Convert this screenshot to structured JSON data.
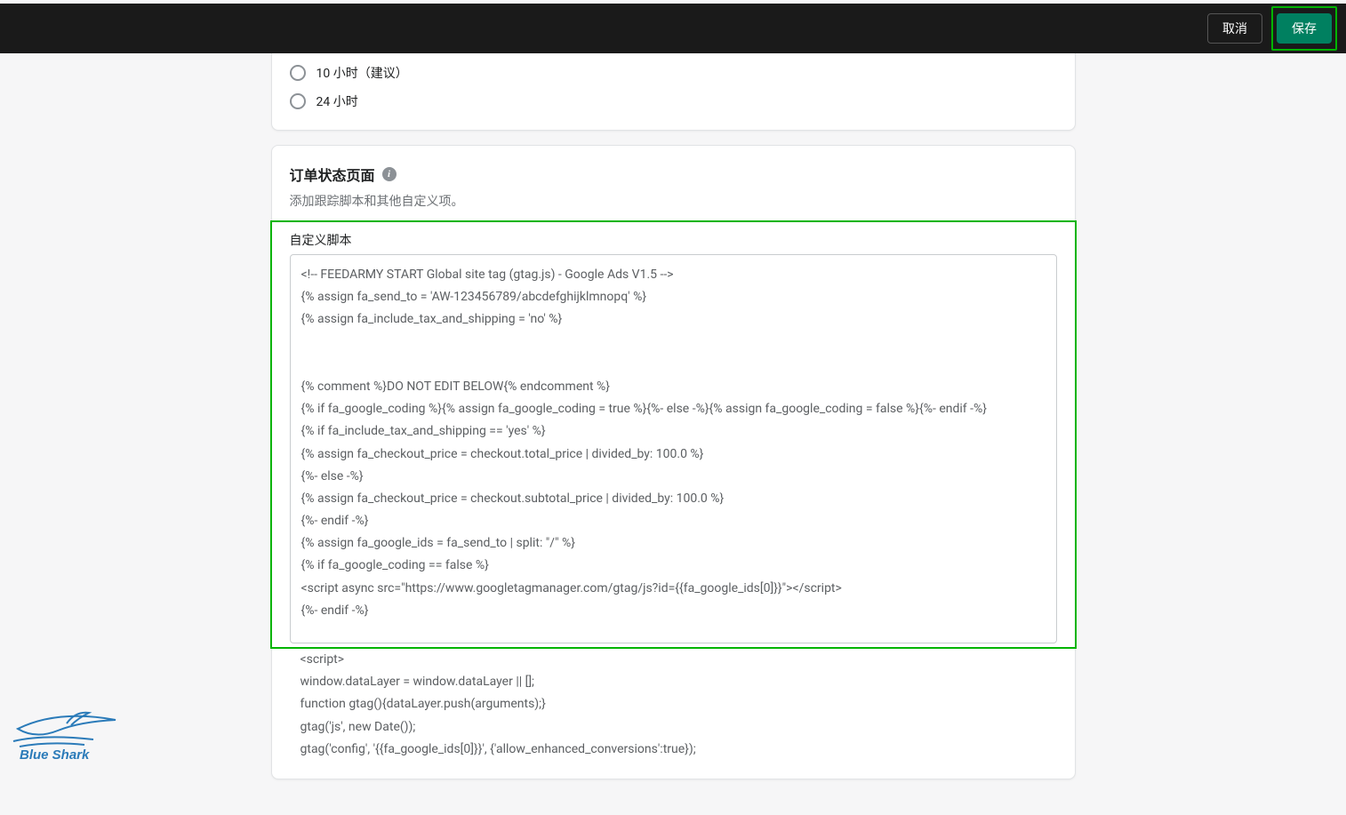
{
  "topbar": {
    "cancel_label": "取消",
    "save_label": "保存"
  },
  "first_card": {
    "options": [
      {
        "label": "10 小时（建议）"
      },
      {
        "label": "24 小时"
      }
    ]
  },
  "order_status": {
    "title": "订单状态页面",
    "subtitle": "添加跟踪脚本和其他自定义项。",
    "field_label": "自定义脚本",
    "script_value": "<!-- FEEDARMY START Global site tag (gtag.js) - Google Ads V1.5 -->\n{% assign fa_send_to = 'AW-123456789/abcdefghijklmnopq' %}\n{% assign fa_include_tax_and_shipping = 'no' %}\n\n\n{% comment %}DO NOT EDIT BELOW{% endcomment %}\n{% if fa_google_coding %}{% assign fa_google_coding = true %}{%- else -%}{% assign fa_google_coding = false %}{%- endif -%}\n{% if fa_include_tax_and_shipping == 'yes' %}\n{% assign fa_checkout_price = checkout.total_price | divided_by: 100.0 %}\n{%- else -%}\n{% assign fa_checkout_price = checkout.subtotal_price | divided_by: 100.0 %}\n{%- endif -%}\n{% assign fa_google_ids = fa_send_to | split: \"/\" %}\n{% if fa_google_coding == false %}\n<script async src=\"https://www.googletagmanager.com/gtag/js?id={{fa_google_ids[0]}}\"></script>\n{%- endif -%}",
    "script_overflow": "<script>\nwindow.dataLayer = window.dataLayer || [];\nfunction gtag(){dataLayer.push(arguments);}\ngtag('js', new Date());\ngtag('config', '{{fa_google_ids[0]}}', {'allow_enhanced_conversions':true});"
  },
  "logo": {
    "text": "Blue Shark"
  }
}
